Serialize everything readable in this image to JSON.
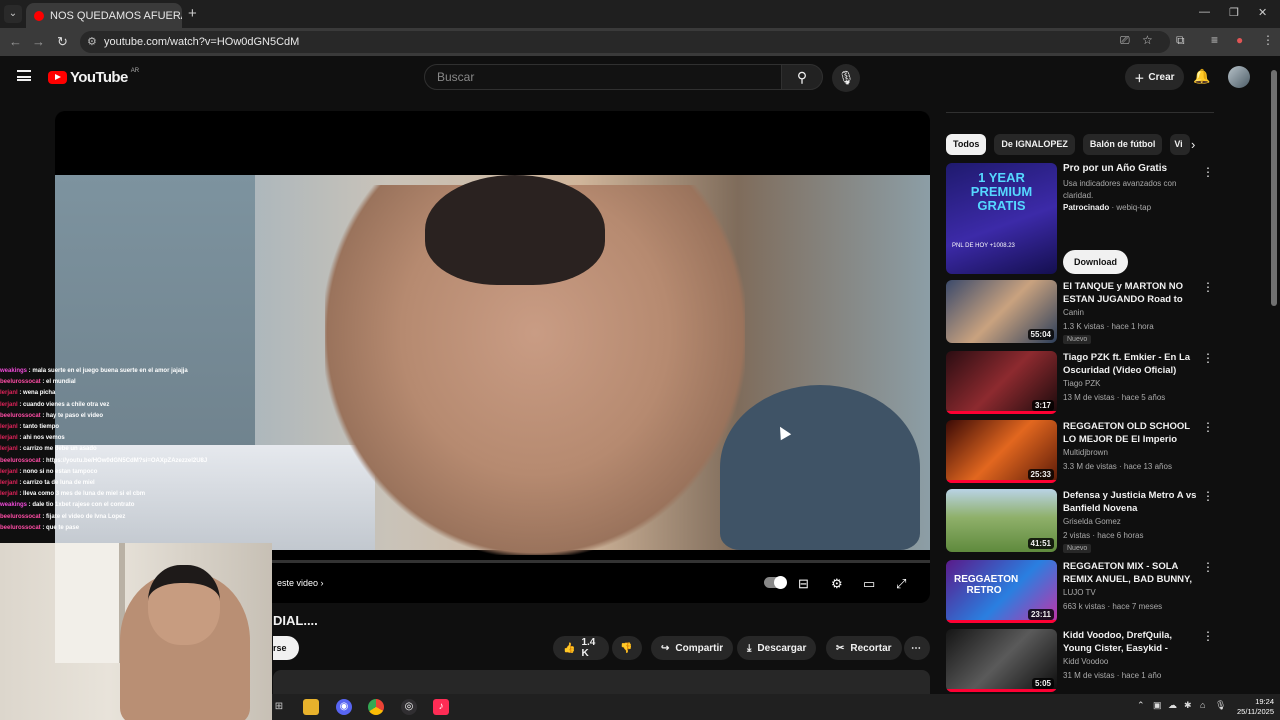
{
  "browser": {
    "tab_title": "NOS QUEDAMOS AFUERA |",
    "url": "youtube.com/watch?v=HOw0dGN5CdM"
  },
  "header": {
    "logo_text": "YouTube",
    "country": "AR",
    "search_placeholder": "Buscar",
    "create_label": "Crear"
  },
  "player": {
    "end_screen_label": "este video",
    "title_fragment": "DIAL....",
    "subscribe_fragment": "rse"
  },
  "actions": {
    "likes": "1.4 K",
    "share": "Compartir",
    "download": "Descargar",
    "clip": "Recortar"
  },
  "chat": [
    {
      "user": "weakings",
      "color": "#f04ad8",
      "msg": "mala suerte en el juego buena suerte en el amor jajajja"
    },
    {
      "user": "beelurossocat",
      "color": "#ff4da6",
      "msg": "el mundial"
    },
    {
      "user": "lerjanl",
      "color": "#e0235a",
      "msg": "wena picha"
    },
    {
      "user": "lerjanl",
      "color": "#e0235a",
      "msg": "cuando vienes a chile otra vez"
    },
    {
      "user": "beelurossocat",
      "color": "#ff4da6",
      "msg": "hay te paso el video"
    },
    {
      "user": "lerjanl",
      "color": "#e0235a",
      "msg": "tanto tiempo"
    },
    {
      "user": "lerjanl",
      "color": "#e0235a",
      "msg": "ahi nos vemos"
    },
    {
      "user": "lerjanl",
      "color": "#e0235a",
      "msg": "carrizo me debe un asado"
    },
    {
      "user": "beelurossocat",
      "color": "#ff4da6",
      "msg": "https://youtu.be/HOw0dGN5CdM?si=OAXpZAzezzel2U8J"
    },
    {
      "user": "lerjanl",
      "color": "#e0235a",
      "msg": "nono si no estan tampoco"
    },
    {
      "user": "lerjanl",
      "color": "#e0235a",
      "msg": "carrizo ta de luna de miel"
    },
    {
      "user": "lerjanl",
      "color": "#e0235a",
      "msg": "lleva como 3 mes de luna de miel si el cbm"
    },
    {
      "user": "weakings",
      "color": "#f04ad8",
      "msg": "dale tio 1xbet rajese con el contrato"
    },
    {
      "user": "beelurossocat",
      "color": "#ff4da6",
      "msg": "fijate el video de Ivna Lopez"
    },
    {
      "user": "beelurossocat",
      "color": "#ff4da6",
      "msg": "que te pase"
    }
  ],
  "sidebar": {
    "chips": [
      "Todos",
      "De IGNALOPEZ",
      "Balón de fútbol",
      "Vi"
    ],
    "ad": {
      "thumb_headline": "1 YEAR PREMIUM GRATIS",
      "thumb_sub": "PNL DE HOY +1008.23",
      "title": "Pro por un Año Gratis",
      "description": "Usa indicadores avanzados con claridad.",
      "sponsored": "Patrocinado",
      "advertiser": "webiq-tap",
      "cta": "Download"
    },
    "videos": [
      {
        "title": "El TANQUE y MARTON NO ESTAN JUGANDO Road to UFA",
        "channel": "Canin",
        "meta": "1.3 K vistas · hace 1 hora",
        "duration": "55:04",
        "badge": "Nuevo",
        "watched": false,
        "thumb": "linear-gradient(135deg,#3b4a6b,#c9a27f 50%,#2c3e5a)"
      },
      {
        "title": "Tiago PZK ft. Emkier - En La Oscuridad (Video Oficial)",
        "channel": "Tiago PZK",
        "meta": "13 M de vistas · hace 5 años",
        "duration": "3:17",
        "badge": "",
        "watched": true,
        "thumb": "linear-gradient(135deg,#2b0d12,#8d2a2f 50%,#1a0a0c)"
      },
      {
        "title": "REGGAETON OLD SCHOOL LO MEJOR DE El Imperio NAZZA ...",
        "channel": "Multidjbrown",
        "meta": "3.3 M de vistas · hace 13 años",
        "duration": "25:33",
        "badge": "",
        "watched": true,
        "thumb": "linear-gradient(135deg,#3b0a06,#e2671f 50%,#5b1a08)"
      },
      {
        "title": "Defensa y Justicia Metro A vs Banfield Novena",
        "channel": "Griselda Gomez",
        "meta": "2 vistas · hace 6 horas",
        "duration": "41:51",
        "badge": "Nuevo",
        "watched": false,
        "thumb": "linear-gradient(180deg,#b9d3e6 0%,#8fb06a 45%,#5f8a3d 100%)"
      },
      {
        "title": "REGGAETON MIX - SOLA REMIX ANUEL, BAD BUNNY, ...",
        "channel": "LUJO TV",
        "meta": "663 k vistas · hace 7 meses",
        "duration": "23:11",
        "badge": "",
        "watched": true,
        "thumb": "linear-gradient(135deg,#5a1a8a,#2a7fe0 55%,#c232a8)"
      },
      {
        "title": "Kidd Voodoo, DrefQuila, Young Cister, Easykid - Enrolar ...",
        "channel": "Kidd Voodoo",
        "meta": "31 M de vistas · hace 1 año",
        "duration": "5:05",
        "badge": "",
        "watched": true,
        "thumb": "linear-gradient(135deg,#151515,#5a5a5a 50%,#0c0c0c)"
      }
    ]
  },
  "thumb_labels": [
    "REGGAETON RETRO"
  ],
  "clock": {
    "time": "19:24",
    "date": "25/11/2025"
  },
  "colors": {
    "bg": "#0f0f0f",
    "accent": "#ff0000",
    "chip_active": "#f1f1f1"
  }
}
